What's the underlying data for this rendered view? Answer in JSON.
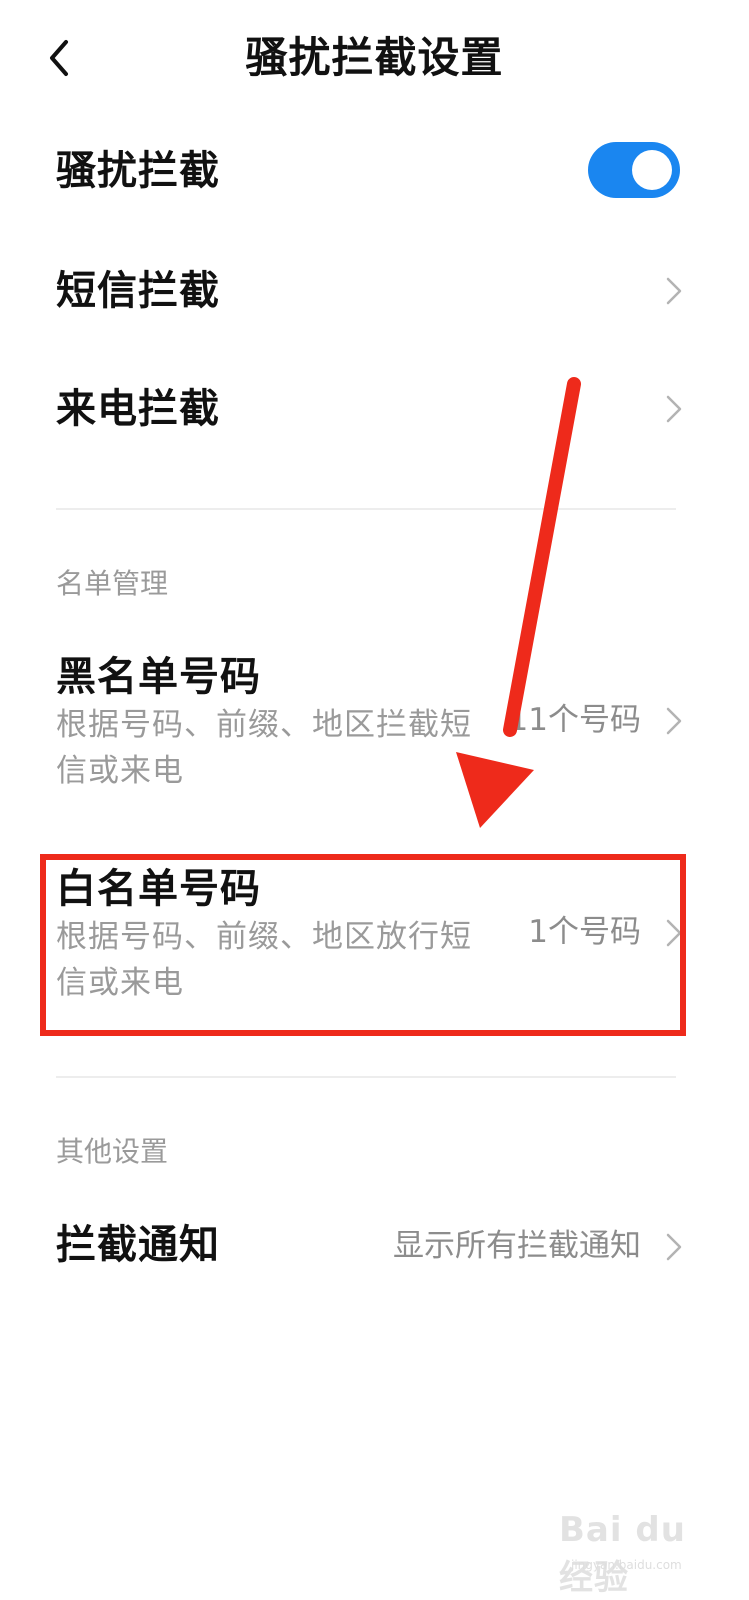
{
  "header": {
    "title": "骚扰拦截设置",
    "back_icon": "chevron-left-icon"
  },
  "settings": {
    "interception": {
      "label": "骚扰拦截",
      "enabled": true,
      "toggle_color": "#1a86f0"
    },
    "sms_block": {
      "label": "短信拦截"
    },
    "call_block": {
      "label": "来电拦截"
    }
  },
  "list_management": {
    "section_label": "名单管理",
    "blacklist": {
      "title": "黑名单号码",
      "subtitle": "根据号码、前缀、地区拦截短信或来电",
      "value": "11个号码"
    },
    "whitelist": {
      "title": "白名单号码",
      "subtitle": "根据号码、前缀、地区放行短信或来电",
      "value": "1个号码"
    }
  },
  "other_settings": {
    "section_label": "其他设置",
    "notification": {
      "title": "拦截通知",
      "value": "显示所有拦截通知"
    }
  },
  "annotation": {
    "color": "#ee2a1b"
  },
  "watermark": {
    "text": "Bai du 经验",
    "url": "jingyan.baidu.com"
  }
}
